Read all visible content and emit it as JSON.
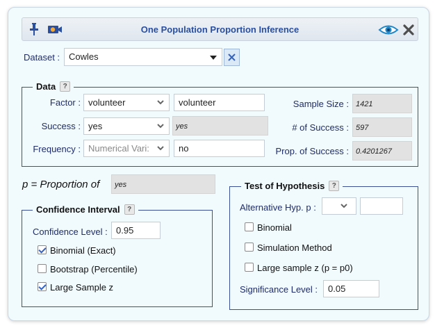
{
  "window": {
    "title": "One Population Proportion Inference"
  },
  "dataset": {
    "label": "Dataset :",
    "value": "Cowles"
  },
  "data_section": {
    "legend": "Data",
    "help": "?",
    "factor": {
      "label": "Factor :",
      "select_value": "volunteer",
      "text_value": "volunteer"
    },
    "success": {
      "label": "Success :",
      "select_value": "yes",
      "readonly_value": "yes"
    },
    "frequency": {
      "label": "Frequency :",
      "select_value": "Numerical Vari:",
      "text_value": "no"
    },
    "sample_size": {
      "label": "Sample Size :",
      "value": "1421"
    },
    "num_success": {
      "label": "# of Success :",
      "value": "597"
    },
    "prop_success": {
      "label": "Prop. of Success :",
      "value": "0.4201267"
    }
  },
  "proportion": {
    "label": "p = Proportion of",
    "value": "yes"
  },
  "confidence": {
    "legend": "Confidence Interval",
    "help": "?",
    "level_label": "Confidence Level :",
    "level_value": "0.95",
    "options": [
      {
        "label": "Binomial (Exact)",
        "checked": true
      },
      {
        "label": "Bootstrap (Percentile)",
        "checked": false
      },
      {
        "label": "Large Sample z",
        "checked": true
      }
    ]
  },
  "hypothesis": {
    "legend": "Test of Hypothesis",
    "help": "?",
    "alt_label": "Alternative Hyp. p :",
    "alt_value": "",
    "p0_value": "",
    "options": [
      {
        "label": "Binomial",
        "checked": false
      },
      {
        "label": "Simulation Method",
        "checked": false
      },
      {
        "label": "Large sample z (p = p0)",
        "checked": false
      }
    ],
    "sig_label": "Significance Level :",
    "sig_value": "0.05"
  },
  "colors": {
    "accent": "#2a4f9e",
    "panel_bg": "#f1fafc",
    "border": "#3a4f95"
  }
}
